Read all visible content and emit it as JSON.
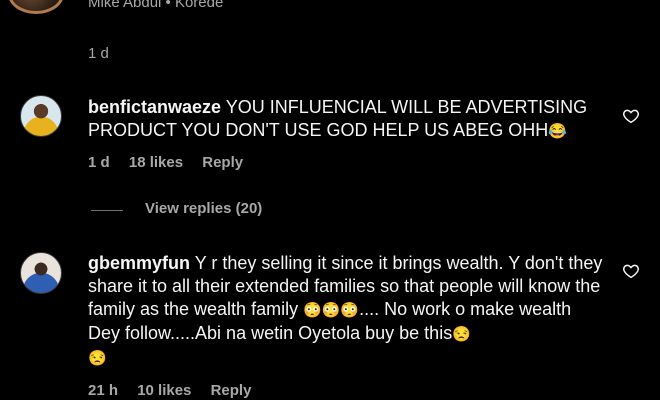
{
  "top": {
    "names": "Mike Abdul • Korede"
  },
  "comments": [
    {
      "time": "1 d"
    },
    {
      "username": "benfictanwaeze",
      "text": "YOU INFLUENCIAL WILL BE ADVERTISING PRODUCT YOU DON'T USE GOD HELP US ABEG OHH",
      "emoji": "😂",
      "time": "1 d",
      "likes": "18 likes",
      "reply": "Reply",
      "view_replies": "View replies (20)",
      "icon": "heart-icon"
    },
    {
      "username": "gbemmyfun",
      "text_a": "Y r they selling it since it brings wealth. Y don't they share it to all their extended families so that people will know the family as the wealth family ",
      "emoji_a": "😳😳😳",
      "text_b": ".... No work o make wealth Dey follow.....Abi na wetin Oyetola buy be this",
      "emoji_b": "😒",
      "emoji_c": "😒",
      "time": "21 h",
      "likes": "10 likes",
      "reply": "Reply",
      "icon": "heart-icon"
    }
  ],
  "colors": {
    "background": "#000000",
    "text": "#f5f5f5",
    "muted": "#a8a8a8"
  }
}
